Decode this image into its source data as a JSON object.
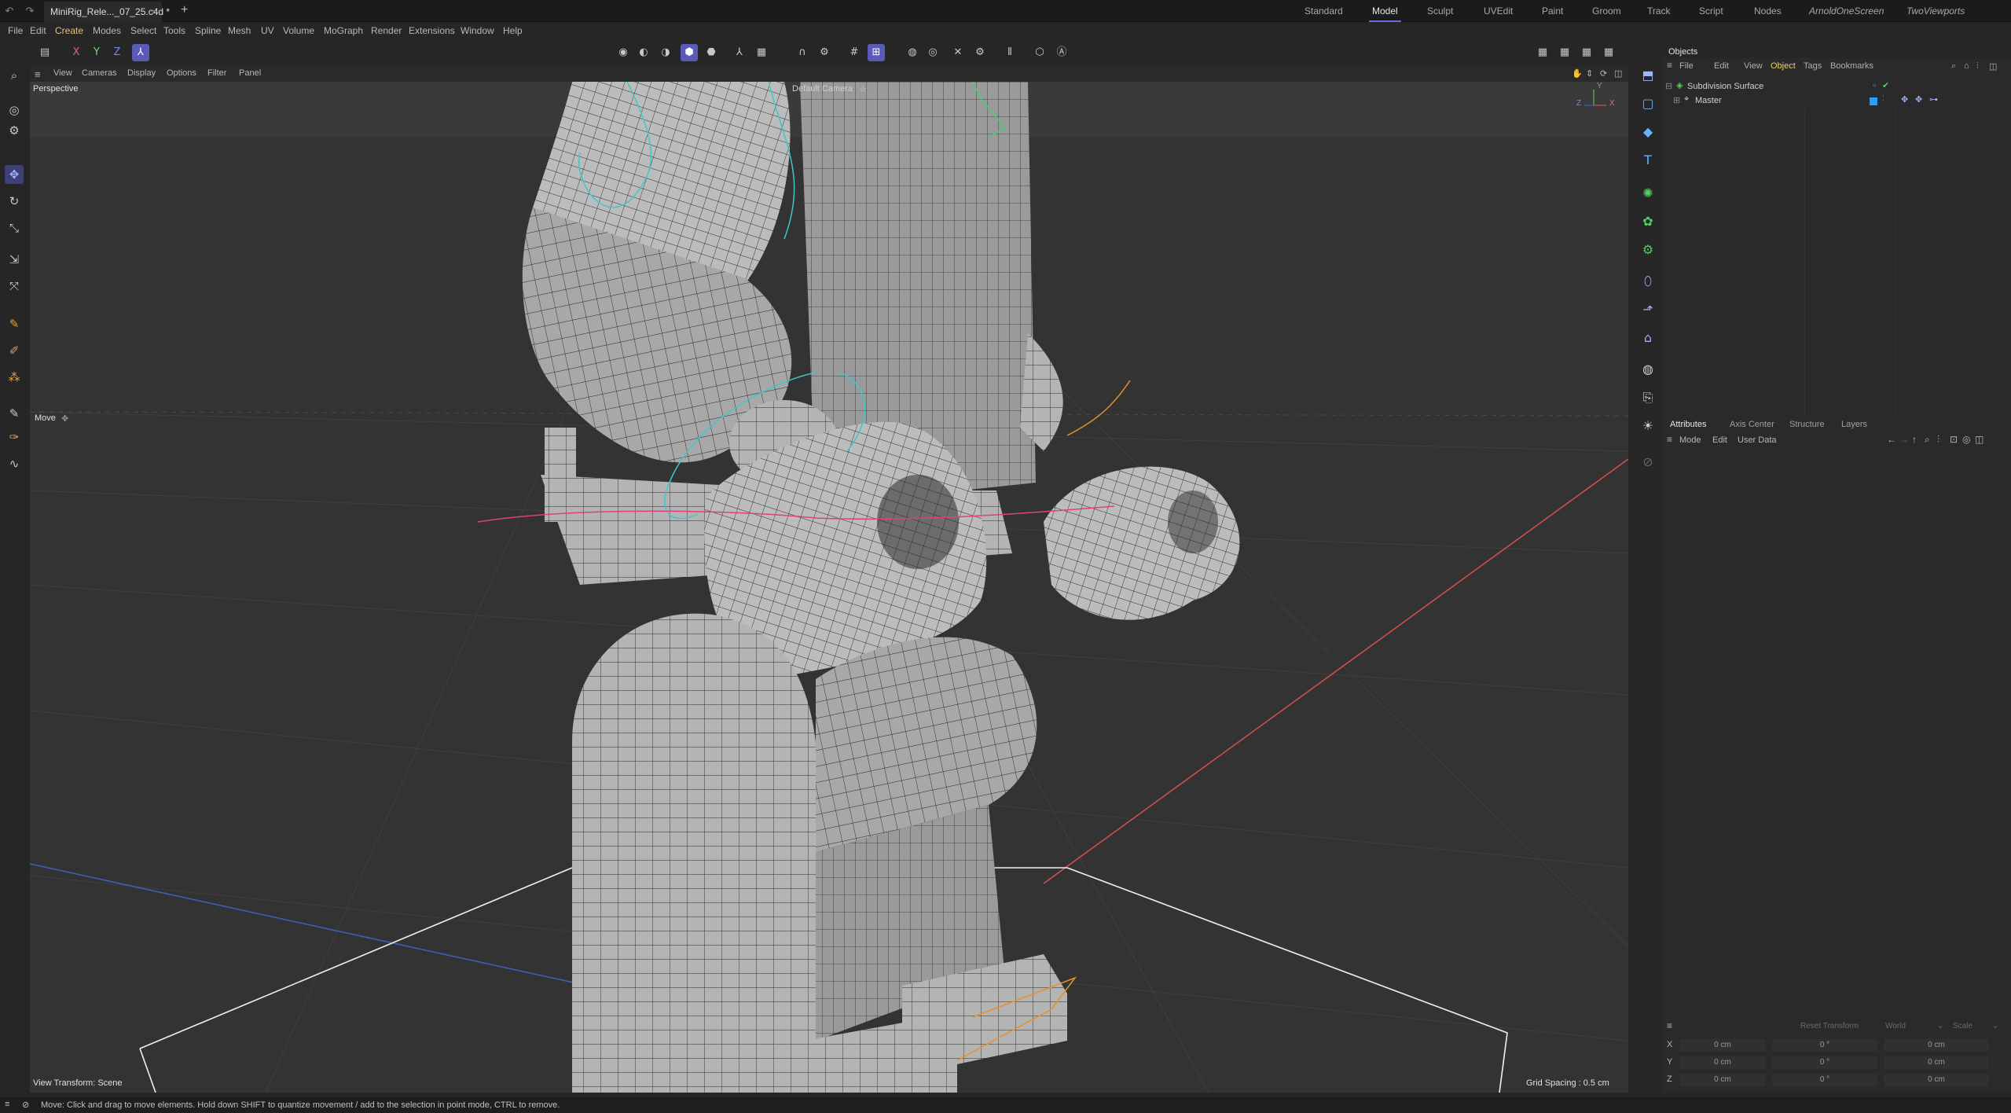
{
  "titlebar": {
    "doc_tab": "MiniRig_Rele..._07_25.c4d *",
    "close_glyph": "×",
    "add_glyph": "+",
    "layouts": [
      "Standard",
      "Model",
      "Sculpt",
      "UVEdit",
      "Paint",
      "Groom",
      "Track",
      "Script",
      "Nodes",
      "ArnoldOneScreen",
      "TwoViewports"
    ],
    "active_layout": "Model"
  },
  "menubar": {
    "items": [
      "File",
      "Edit",
      "Create",
      "Modes",
      "Select",
      "Tools",
      "Spline",
      "Mesh",
      "UV",
      "Volume",
      "MoGraph",
      "Render",
      "Extensions",
      "Window",
      "Help"
    ],
    "highlighted": "Create"
  },
  "toolbar": {
    "axis_x": "X",
    "axis_y": "Y",
    "axis_z": "Z"
  },
  "viewport": {
    "menu": [
      "View",
      "Cameras",
      "Display",
      "Options",
      "Filter",
      "Panel"
    ],
    "name": "Perspective",
    "camera": "Default Camera",
    "camera_icon": "☆",
    "tool_label": "Move",
    "view_transform": "View Transform: Scene",
    "grid_spacing": "Grid Spacing : 0.5 cm",
    "axis_labels": {
      "y": "Y",
      "z": "Z",
      "x": "X"
    }
  },
  "objects": {
    "title": "Objects",
    "menu": [
      "File",
      "Edit",
      "View",
      "Object",
      "Tags",
      "Bookmarks"
    ],
    "active_menu": "Object",
    "rows": [
      {
        "name": "Subdivision Surface"
      },
      {
        "name": "Master"
      }
    ]
  },
  "attributes": {
    "tabs": [
      "Attributes",
      "Axis Center",
      "Structure",
      "Layers"
    ],
    "active_tab": "Attributes",
    "menu": [
      "Mode",
      "Edit",
      "User Data"
    ],
    "coord_bar": {
      "reset": "Reset Transform",
      "space": "World",
      "scale": "Scale"
    },
    "coords": [
      {
        "axis": "X",
        "pos": "0 cm",
        "rot": "0 °",
        "size": "0 cm"
      },
      {
        "axis": "Y",
        "pos": "0 cm",
        "rot": "0 °",
        "size": "0 cm"
      },
      {
        "axis": "Z",
        "pos": "0 cm",
        "rot": "0 °",
        "size": "0 cm"
      }
    ]
  },
  "status": {
    "text": "Move: Click and drag to move elements. Hold down SHIFT to quantize movement / add to the selection in point mode, CTRL to remove."
  },
  "colors": {
    "accent": "#5a5ab8",
    "highlight": "#e8c36b",
    "spline_cyan": "#3ec8c8",
    "spline_pink": "#e0407a",
    "spline_orange": "#e8902a",
    "axis_red": "#d85050",
    "axis_blue": "#4060c0"
  }
}
